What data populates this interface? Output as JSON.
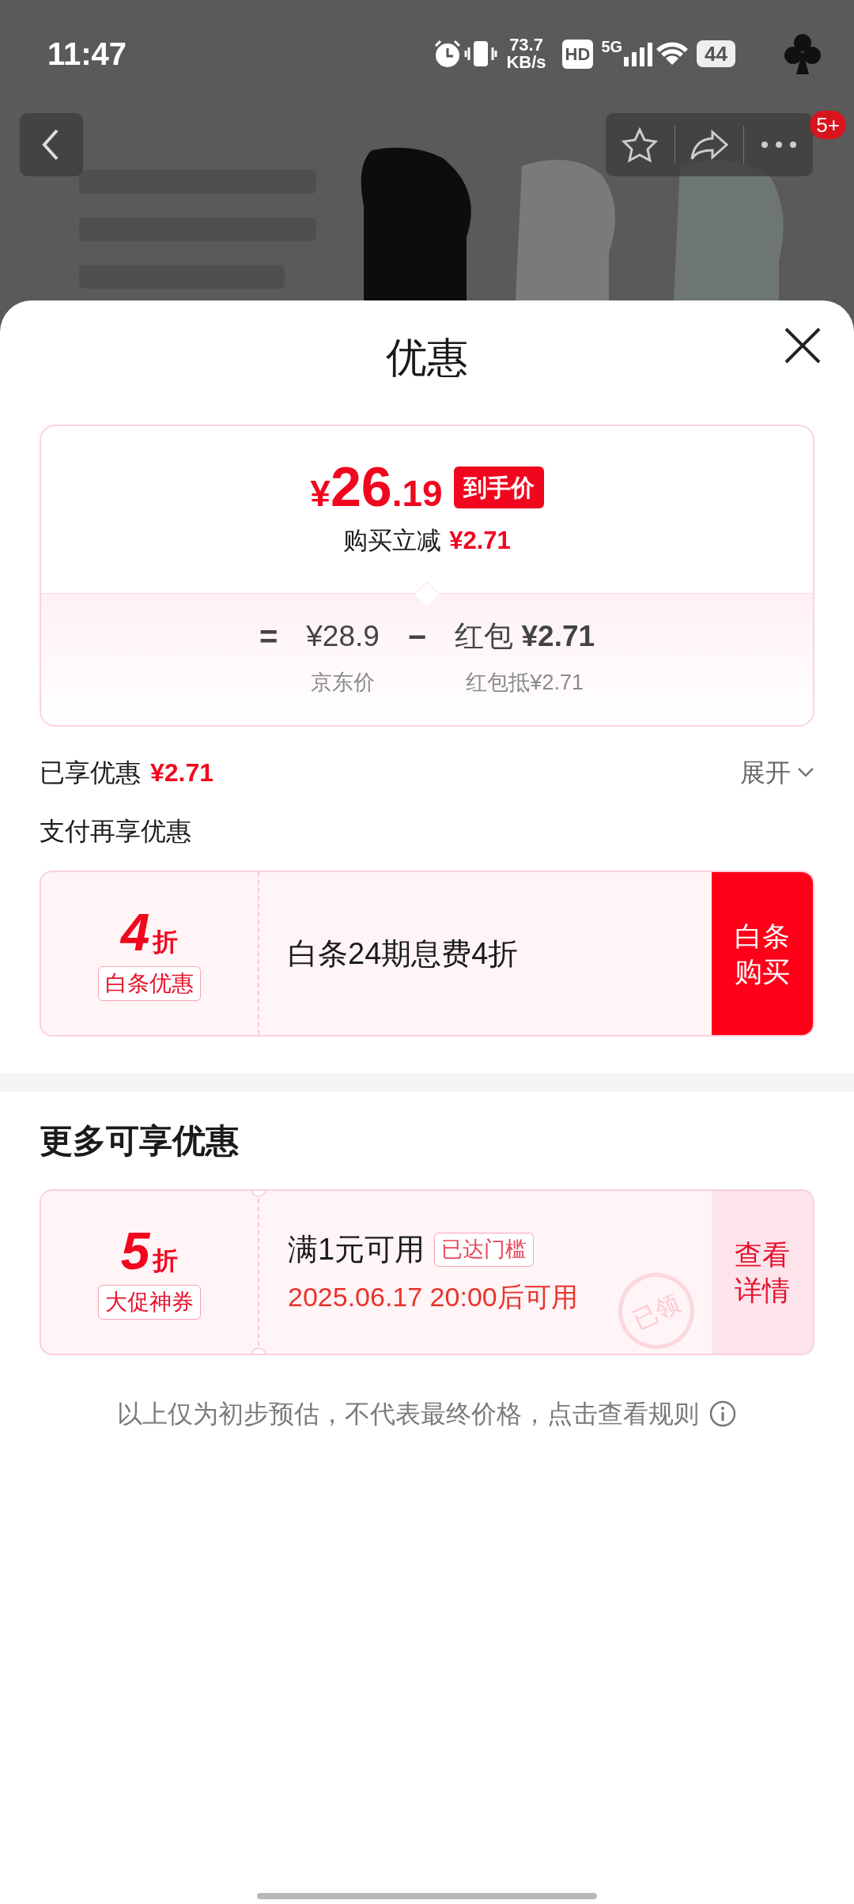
{
  "status_bar": {
    "time": "11:47",
    "speed_value": "73.7",
    "speed_unit": "KB/s",
    "hd": "HD",
    "network": "5G",
    "battery": "44"
  },
  "top_nav": {
    "badge": "5+"
  },
  "sheet": {
    "title": "优惠"
  },
  "price_card": {
    "currency": "¥",
    "amount": "26",
    "decimals": ".19",
    "price_tag": "到手价",
    "saving_label": "购买立减",
    "saving": "¥2.71",
    "formula": [
      {
        "kind": "op",
        "text": "="
      },
      {
        "kind": "term",
        "text": "¥28.9",
        "caption": "京东价"
      },
      {
        "kind": "op",
        "text": "−"
      },
      {
        "kind": "term",
        "text": "红包 **¥2.71**",
        "caption": "红包抵¥2.71"
      }
    ]
  },
  "enjoyed": {
    "label": "已享优惠",
    "amount": "¥2.71",
    "toggle": "展开",
    "expanded": false
  },
  "pay_offers": {
    "title": "支付再享优惠",
    "coupons": [
      {
        "kind": "baitiao",
        "discount": "4",
        "unit": "折",
        "tag": "白条优惠",
        "title": "白条24期息费4折",
        "action": "白条购买"
      }
    ]
  },
  "more_offers": {
    "title": "更多可享优惠",
    "coupons": [
      {
        "kind": "promo",
        "discount": "5",
        "unit": "折",
        "tag": "大促神券",
        "title": "满1元可用",
        "badge": "已达门槛",
        "note": "2025.06.17 20:00后可用",
        "action": "查看详情",
        "stamp": "已领"
      }
    ]
  },
  "disclaimer": "以上仅为初步预估，不代表最终价格，点击查看规则"
}
